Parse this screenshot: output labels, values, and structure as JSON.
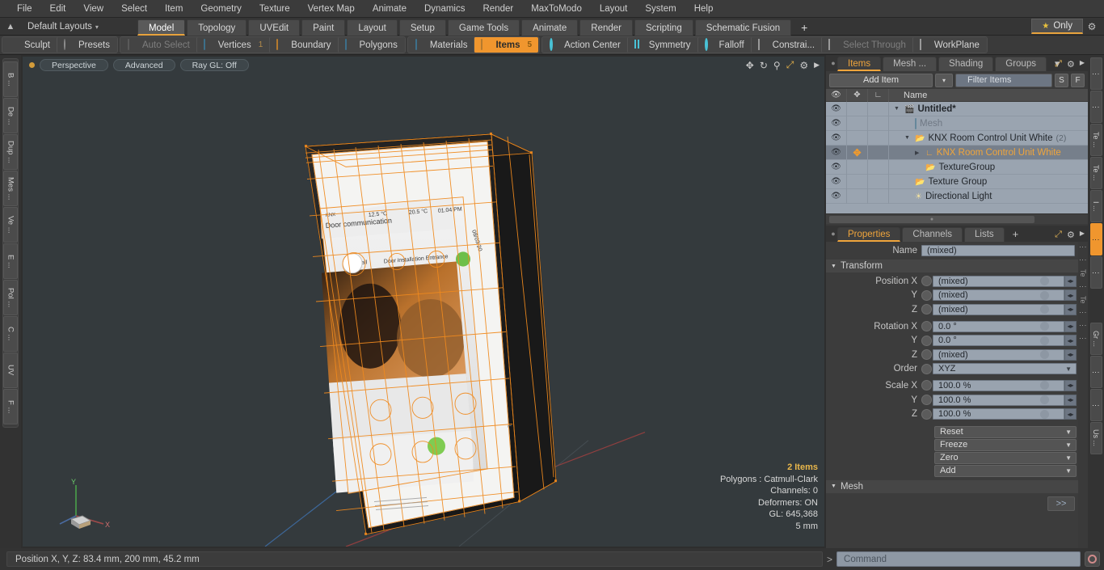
{
  "menubar": {
    "items": [
      "File",
      "Edit",
      "View",
      "Select",
      "Item",
      "Geometry",
      "Texture",
      "Vertex Map",
      "Animate",
      "Dynamics",
      "Render",
      "MaxToModo",
      "Layout",
      "System",
      "Help"
    ]
  },
  "layoutbar": {
    "home_icon": "home-up-icon",
    "layouts_label": "Default Layouts",
    "caret": "▾",
    "tabs": [
      {
        "label": "Model",
        "active": true
      },
      {
        "label": "Topology",
        "active": false
      },
      {
        "label": "UVEdit",
        "active": false
      },
      {
        "label": "Paint",
        "active": false
      },
      {
        "label": "Layout",
        "active": false
      },
      {
        "label": "Setup",
        "active": false
      },
      {
        "label": "Game Tools",
        "active": false
      },
      {
        "label": "Animate",
        "active": false
      },
      {
        "label": "Render",
        "active": false
      },
      {
        "label": "Scripting",
        "active": false
      },
      {
        "label": "Schematic Fusion",
        "active": false
      }
    ],
    "add_tab": "+",
    "only_label": "Only",
    "star_glyph": "★",
    "gear_glyph": "⚙"
  },
  "modebar": {
    "group1": [
      {
        "label": "Sculpt",
        "icon": "brush-icon",
        "state": "normal"
      },
      {
        "label": "Presets",
        "icon": "sphere-icon",
        "state": "normal"
      }
    ],
    "group2": [
      {
        "label": "Auto Select",
        "icon": "cube-grey-icon",
        "state": "dim",
        "count": ""
      },
      {
        "label": "Vertices",
        "icon": "cube-icon",
        "state": "normal",
        "count": "1"
      },
      {
        "label": "Boundary",
        "icon": "boundary-icon",
        "state": "normal",
        "count": ""
      },
      {
        "label": "Polygons",
        "icon": "cube-icon",
        "state": "normal",
        "count": ""
      }
    ],
    "group3": [
      {
        "label": "Materials",
        "icon": "cube-icon",
        "state": "normal",
        "count": ""
      },
      {
        "label": "Items",
        "icon": "cube-orange-icon",
        "state": "selected",
        "count": "5"
      }
    ],
    "group4": [
      {
        "label": "Action Center",
        "icon": "action-center-icon",
        "state": "normal"
      },
      {
        "label": "Symmetry",
        "icon": "symmetry-icon",
        "state": "normal"
      },
      {
        "label": "Falloff",
        "icon": "falloff-icon",
        "state": "normal"
      },
      {
        "label": "Constrai...",
        "icon": "constraint-icon",
        "state": "normal"
      },
      {
        "label": "Select Through",
        "icon": "select-through-icon",
        "state": "dim"
      },
      {
        "label": "WorkPlane",
        "icon": "workplane-icon",
        "state": "normal"
      }
    ]
  },
  "left_rail": {
    "tabs": [
      "B ...",
      "De ...",
      "Dup ...",
      "Mes ...",
      "Ve ...",
      "E ...",
      "Pol ...",
      "C ...",
      "UV",
      "F ..."
    ]
  },
  "viewport": {
    "mode_label": "Perspective",
    "shading_label": "Advanced",
    "raygl_label": "Ray GL: Off",
    "icons": [
      "move-icon",
      "rotate-icon",
      "zoom-icon",
      "maximize-icon",
      "gear-icon",
      "chevron-right-icon"
    ],
    "stats": {
      "items": "2 Items",
      "polygons": "Polygons : Catmull-Clark",
      "channels": "Channels: 0",
      "deformers": "Deformers: ON",
      "gl": "GL: 645,368",
      "scale": "5 mm"
    },
    "axis_labels": {
      "y": "Y",
      "x": "X"
    },
    "model": {
      "device_brand": "KNX",
      "screen_title": "Door communication",
      "temp_outside": "12.5 °C",
      "temp_inside": "20.5 °C",
      "time": "01.04 PM",
      "date": "08/03/20",
      "tab_left": "Door call",
      "tab_right": "Door installation Entrance"
    }
  },
  "items_panel": {
    "tabs": [
      {
        "label": "Items",
        "active": true
      },
      {
        "label": "Mesh ...",
        "active": false
      },
      {
        "label": "Shading",
        "active": false
      },
      {
        "label": "Groups",
        "active": false
      }
    ],
    "tab_overflow": "▾",
    "tools": [
      "expand-icon",
      "gear-icon",
      "chevron-right-icon"
    ],
    "add_item_label": "Add Item",
    "add_item_caret": "▾",
    "filter_placeholder": "Filter Items",
    "btn_s": "S",
    "btn_f": "F",
    "columns": {
      "eye": "eye-icon",
      "move": "move-icon",
      "axis": "axis-icon",
      "name": "Name"
    },
    "rows": [
      {
        "name": "Untitled*",
        "icon": "scene-icon",
        "indent": 0,
        "style": "bold",
        "triangle": "▼",
        "count": "",
        "selected": false,
        "has_move": false
      },
      {
        "name": "Mesh",
        "icon": "mesh-icon",
        "indent": 1,
        "style": "grey",
        "triangle": "",
        "count": "",
        "selected": false,
        "has_move": false
      },
      {
        "name": "KNX Room Control Unit White",
        "icon": "group-icon",
        "indent": 1,
        "style": "normal",
        "triangle": "▼",
        "count": "(2)",
        "selected": false,
        "has_move": false
      },
      {
        "name": "KNX Room Control Unit White",
        "icon": "locator-icon",
        "indent": 2,
        "style": "orange",
        "triangle": "▶",
        "count": "",
        "selected": true,
        "has_move": true
      },
      {
        "name": "TextureGroup",
        "icon": "group-icon",
        "indent": 2,
        "style": "normal",
        "triangle": "",
        "count": "",
        "selected": false,
        "has_move": false
      },
      {
        "name": "Texture Group",
        "icon": "group-icon",
        "indent": 1,
        "style": "normal",
        "triangle": "",
        "count": "",
        "selected": false,
        "has_move": false
      },
      {
        "name": "Directional Light",
        "icon": "light-icon",
        "indent": 1,
        "style": "normal",
        "triangle": "",
        "count": "",
        "selected": false,
        "has_move": false
      }
    ]
  },
  "properties_panel": {
    "tabs": [
      {
        "label": "Properties",
        "active": true
      },
      {
        "label": "Channels",
        "active": false
      },
      {
        "label": "Lists",
        "active": false
      }
    ],
    "add_tab": "+",
    "tools": [
      "expand-icon",
      "gear-icon",
      "chevron-right-icon"
    ],
    "name_label": "Name",
    "name_value": "(mixed)",
    "transform_section": "Transform",
    "fields": [
      {
        "label": "Position X",
        "value": "(mixed)"
      },
      {
        "label": "Y",
        "value": "(mixed)"
      },
      {
        "label": "Z",
        "value": "(mixed)"
      },
      {
        "label": "Rotation X",
        "value": "0.0 °"
      },
      {
        "label": "Y",
        "value": "0.0 °"
      },
      {
        "label": "Z",
        "value": "(mixed)"
      }
    ],
    "order_label": "Order",
    "order_value": "XYZ",
    "scale_fields": [
      {
        "label": "Scale X",
        "value": "100.0 %"
      },
      {
        "label": "Y",
        "value": "100.0 %"
      },
      {
        "label": "Z",
        "value": "100.0 %"
      }
    ],
    "dropdowns": [
      "Reset",
      "Freeze",
      "Zero",
      "Add"
    ],
    "mesh_section": "Mesh",
    "more_button": ">>"
  },
  "right_rail": {
    "tabs": [
      {
        "label": "⋮",
        "on": false
      },
      {
        "label": "⋮",
        "on": false
      },
      {
        "label": "Te ...",
        "on": false
      },
      {
        "label": "Te ...",
        "on": false
      },
      {
        "label": "I ...",
        "on": false
      },
      {
        "label": "⋮",
        "on": true
      },
      {
        "label": "⋮",
        "on": false
      },
      {
        "label": "",
        "on": false
      },
      {
        "label": "Gr ...",
        "on": false
      },
      {
        "label": "⋮",
        "on": false
      },
      {
        "label": "⋮",
        "on": false
      },
      {
        "label": "Us ...",
        "on": false
      }
    ]
  },
  "statusbar": {
    "position_text": "Position X, Y, Z:   83.4 mm, 200 mm, 45.2 mm",
    "prompt": ">",
    "command_placeholder": "Command",
    "record_icon": "record-icon"
  },
  "colors": {
    "accent_orange": "#f0962e",
    "tab_orange": "#f0a53c",
    "wireframe_orange": "#f08a1e",
    "panel_bg": "#3a3a3a",
    "viewport_bg": "#343a3d",
    "field_blue": "#99a3af"
  }
}
